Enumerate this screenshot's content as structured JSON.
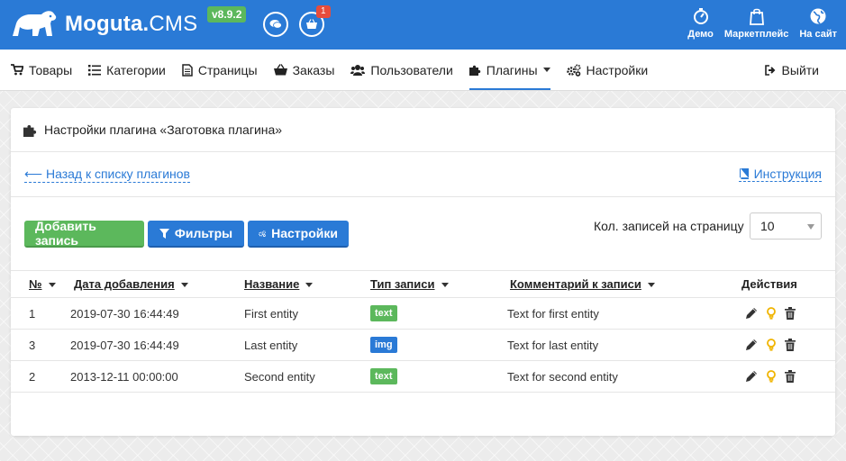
{
  "header": {
    "logo_text_main": "Moguta.",
    "logo_text_cms": "CMS",
    "version": "v8.9.2",
    "cart_badge": "1",
    "links": [
      {
        "label": "Демо",
        "icon": "speedometer-icon"
      },
      {
        "label": "Маркетплейс",
        "icon": "shopping-bag-icon"
      },
      {
        "label": "На сайт",
        "icon": "globe-icon"
      }
    ]
  },
  "nav": {
    "items": [
      {
        "label": "Товары",
        "icon": "cart-icon"
      },
      {
        "label": "Категории",
        "icon": "list-icon"
      },
      {
        "label": "Страницы",
        "icon": "file-icon"
      },
      {
        "label": "Заказы",
        "icon": "basket-icon"
      },
      {
        "label": "Пользователи",
        "icon": "users-icon"
      },
      {
        "label": "Плагины",
        "icon": "puzzle-icon",
        "active": true
      },
      {
        "label": "Настройки",
        "icon": "gears-icon"
      }
    ],
    "logout": "Выйти"
  },
  "panel": {
    "title": "Настройки плагина «Заготовка плагина»",
    "back_link": "⟵ Назад к списку плагинов",
    "instruction_link": "Инструкция",
    "buttons": {
      "add": "Добавить запись",
      "filters": "Фильтры",
      "settings": "Настройки"
    },
    "per_page_label": "Кол. записей на страницу",
    "per_page_value": "10"
  },
  "table": {
    "columns": [
      "№",
      "Дата добавления",
      "Название",
      "Тип записи",
      "Комментарий к записи",
      "Действия"
    ],
    "rows": [
      {
        "num": "1",
        "date": "2019-07-30 16:44:49",
        "name": "First entity",
        "type": "text",
        "type_color": "#5cb85c",
        "comment": "Text for first entity"
      },
      {
        "num": "3",
        "date": "2019-07-30 16:44:49",
        "name": "Last entity",
        "type": "img",
        "type_color": "#2a7ad6",
        "comment": "Text for last entity"
      },
      {
        "num": "2",
        "date": "2013-12-11 00:00:00",
        "name": "Second entity",
        "type": "text",
        "type_color": "#5cb85c",
        "comment": "Text for second entity"
      }
    ]
  },
  "colors": {
    "primary": "#2a7ad6",
    "success": "#5cb85c",
    "danger": "#e74c3c",
    "bulb": "#f0b400"
  }
}
